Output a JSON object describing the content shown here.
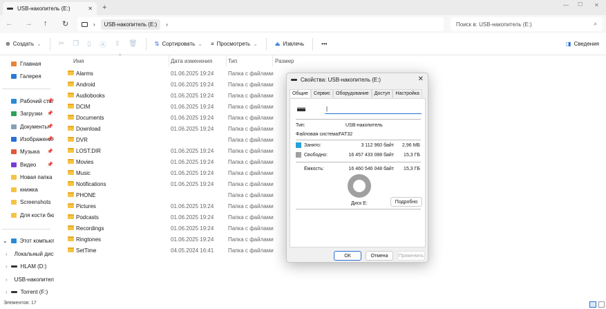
{
  "window": {
    "tab_title": "USB-накопитель (E:)",
    "new_tab": "+",
    "close_tab": "✕",
    "minimize": "—",
    "maximize": "☐",
    "close": "✕"
  },
  "address": {
    "crumb": "USB-накопитель (E:)",
    "search_placeholder": "Поиск в: USB-накопитель (E:)"
  },
  "toolbar": {
    "create": "Создать",
    "sort": "Сортировать",
    "view": "Просмотреть",
    "eject": "Извлечь",
    "more": "•••",
    "details": "Сведения"
  },
  "sidebar": {
    "top": [
      {
        "label": "Главная",
        "color": "#e8833a"
      },
      {
        "label": "Галерея",
        "color": "#2a7bd5"
      }
    ],
    "pinned": [
      {
        "label": "Рабочий стол",
        "color": "#2a8ad5"
      },
      {
        "label": "Загрузки",
        "color": "#2aa35a"
      },
      {
        "label": "Документы",
        "color": "#8aa0b8"
      },
      {
        "label": "Изображения",
        "color": "#2a6fd5"
      },
      {
        "label": "Музыка",
        "color": "#e05a3a"
      },
      {
        "label": "Видео",
        "color": "#7a3ad5"
      },
      {
        "label": "Новая папка",
        "color": "#f5c443"
      },
      {
        "label": "книжка",
        "color": "#f5c443"
      },
      {
        "label": "Screenshots",
        "color": "#f5c443"
      },
      {
        "label": "Для кости бюзг",
        "color": "#f5c443"
      }
    ],
    "this_pc": "Этот компьютер",
    "drives": [
      "Локальный диск",
      "HLAM (D:)",
      "USB-накопитель",
      "Torrent (F:)"
    ]
  },
  "columns": {
    "name": "Имя",
    "date": "Дата изменения",
    "type": "Тип",
    "size": "Размер"
  },
  "files": [
    {
      "name": "Alarms",
      "date": "01.06.2025 19:24",
      "type": "Папка с файлами"
    },
    {
      "name": "Android",
      "date": "01.06.2025 19:24",
      "type": "Папка с файлами"
    },
    {
      "name": "Audiobooks",
      "date": "01.06.2025 19:24",
      "type": "Папка с файлами"
    },
    {
      "name": "DCIM",
      "date": "01.06.2025 19:24",
      "type": "Папка с файлами"
    },
    {
      "name": "Documents",
      "date": "01.06.2025 19:24",
      "type": "Папка с файлами"
    },
    {
      "name": "Download",
      "date": "01.06.2025 19:24",
      "type": "Папка с файлами"
    },
    {
      "name": "DVR",
      "date": "",
      "type": "Папка с файлами"
    },
    {
      "name": "LOST.DIR",
      "date": "01.06.2025 19:24",
      "type": "Папка с файлами"
    },
    {
      "name": "Movies",
      "date": "01.06.2025 19:24",
      "type": "Папка с файлами"
    },
    {
      "name": "Music",
      "date": "01.06.2025 19:24",
      "type": "Папка с файлами"
    },
    {
      "name": "Notifications",
      "date": "01.06.2025 19:24",
      "type": "Папка с файлами"
    },
    {
      "name": "PHONE",
      "date": "",
      "type": "Папка с файлами"
    },
    {
      "name": "Pictures",
      "date": "01.06.2025 19:24",
      "type": "Папка с файлами"
    },
    {
      "name": "Podcasts",
      "date": "01.06.2025 19:24",
      "type": "Папка с файлами"
    },
    {
      "name": "Recordings",
      "date": "01.06.2025 19:24",
      "type": "Папка с файлами"
    },
    {
      "name": "Ringtones",
      "date": "01.06.2025 19:24",
      "type": "Папка с файлами"
    },
    {
      "name": "SetTime",
      "date": "04.05.2024 16:41",
      "type": "Папка с файлами"
    }
  ],
  "status": "Элементов: 17",
  "dialog": {
    "title": "Свойства: USB-накопитель (E:)",
    "tabs": [
      "Общие",
      "Сервис",
      "Оборудование",
      "Доступ",
      "Настройка"
    ],
    "name_value": "",
    "type_label": "Тип:",
    "type_value": "USB-накопитель",
    "fs_label": "Файловая система:",
    "fs_value": "FAT32",
    "used_label": "Занято:",
    "used_bytes": "3 112 960 байт",
    "used_human": "2,96 МБ",
    "free_label": "Свободно:",
    "free_bytes": "16 457 433 088 байт",
    "free_human": "15,3 ГБ",
    "cap_label": "Ёмкость:",
    "cap_bytes": "16 460 546 048 байт",
    "cap_human": "15,3 ГБ",
    "disk_label": "Диск E:",
    "details_btn": "Подробно",
    "ok": "ОК",
    "cancel": "Отмена",
    "apply": "Применить",
    "used_fraction": 0.00019,
    "used_color": "#26a0da",
    "free_color": "#a0a0a0"
  }
}
